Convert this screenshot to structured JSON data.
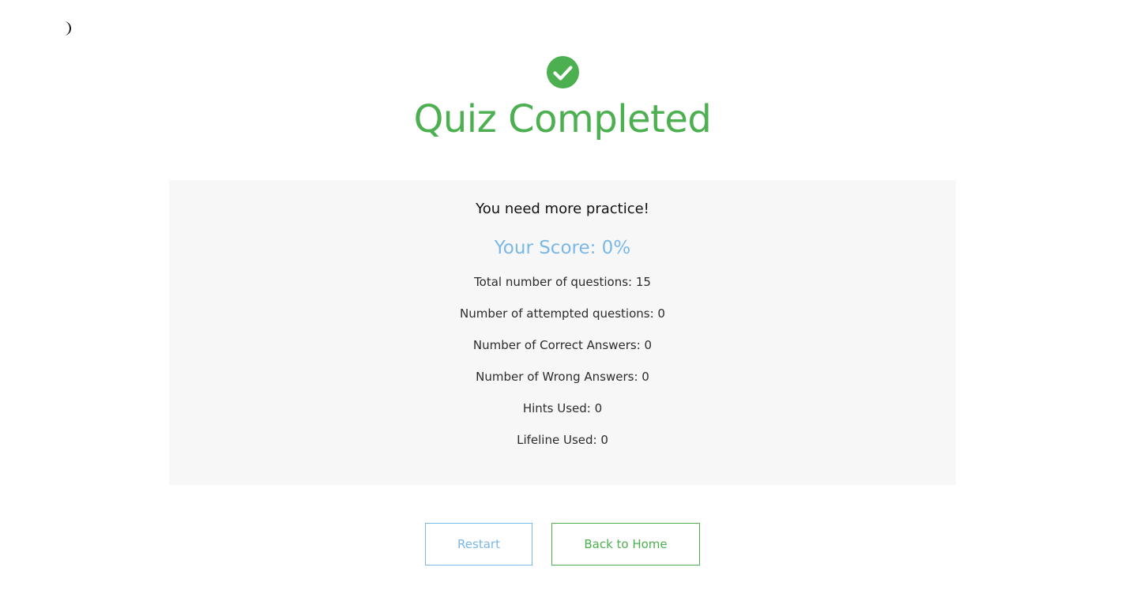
{
  "theme_toggle": {
    "icon": "moon-icon"
  },
  "header": {
    "icon": "check-circle-icon",
    "title": "Quiz Completed"
  },
  "results": {
    "remark": "You need more practice!",
    "score_text": "Your Score: 0%",
    "score_percent": 0,
    "stats": [
      "Total number of questions: 15",
      "Number of attempted questions: 0",
      "Number of Correct Answers: 0",
      "Number of Wrong Answers: 0",
      "Hints Used: 0",
      "Lifeline Used: 0"
    ]
  },
  "actions": {
    "restart_label": "Restart",
    "home_label": "Back to Home"
  },
  "colors": {
    "success": "#4caf50",
    "accent": "#7ab8e6",
    "panel_bg": "#f7f7f7"
  }
}
